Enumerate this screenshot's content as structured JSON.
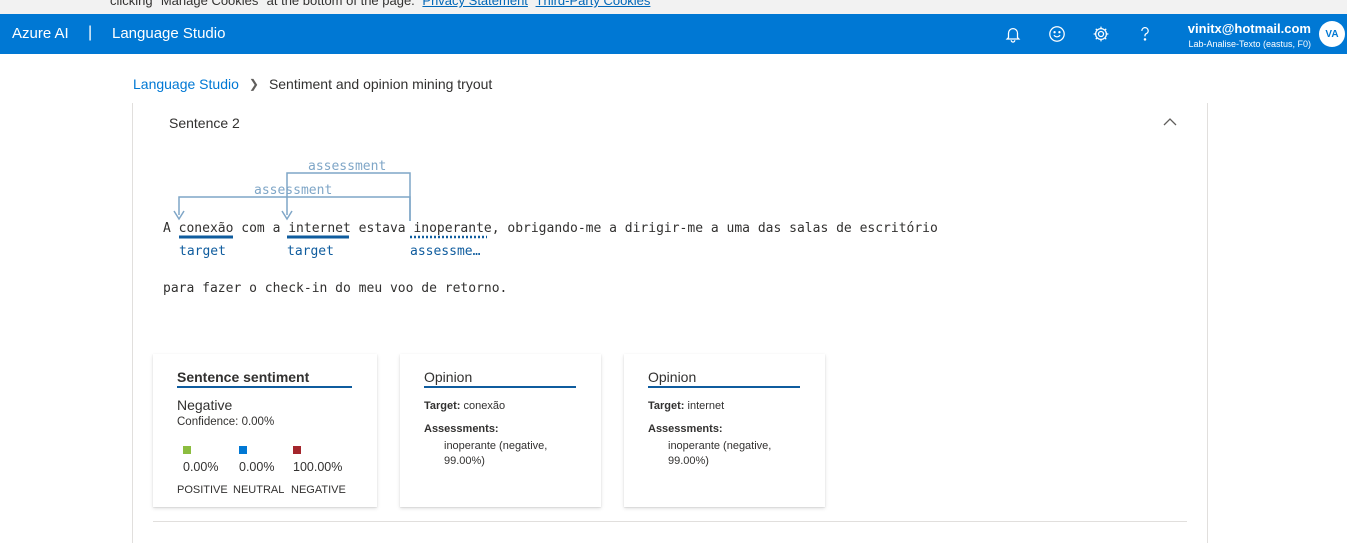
{
  "cookie_banner": {
    "text": "clicking \"Manage Cookies\" at the bottom of the page.",
    "privacy_link": "Privacy Statement",
    "third_party_link": "Third-Party Cookies"
  },
  "topbar": {
    "brand": "Azure AI",
    "separator": "|",
    "product": "Language Studio",
    "icons": [
      "bell-icon",
      "smiley-icon",
      "gear-icon",
      "help-icon"
    ],
    "user_email": "vinitx@hotmail.com",
    "user_tenant": "Lab-Analise-Texto (eastus, F0)",
    "avatar_initials": "VA",
    "bg_color": "#0078d4"
  },
  "breadcrumb": {
    "root": "Language Studio",
    "current": "Sentiment and opinion mining tryout"
  },
  "sentence": {
    "title": "Sentence 2",
    "line1": "A conexão com a internet estava inoperante, obrigando-me a dirigir-me a uma das salas de escritório",
    "line2": "para fazer o check-in do meu voo de retorno.",
    "tags": {
      "target1": "target",
      "target2": "target",
      "assessment": "assessme…"
    },
    "arc1_label": "assessment",
    "arc2_label": "assessment"
  },
  "sentence_card": {
    "title": "Sentence sentiment",
    "sentiment": "Negative",
    "confidence": "Confidence: 0.00%",
    "scores": [
      {
        "label": "POSITIVE",
        "value": "0.00%",
        "color": "#8cbd3f"
      },
      {
        "label": "NEUTRAL",
        "value": "0.00%",
        "color": "#0078d4"
      },
      {
        "label": "NEGATIVE",
        "value": "100.00%",
        "color": "#a4262c"
      }
    ]
  },
  "opinions": [
    {
      "title": "Opinion",
      "target_label": "Target:",
      "target_value": "conexão",
      "assessments_label": "Assessments:",
      "assessment_value": "inoperante (negative, 99.00%)"
    },
    {
      "title": "Opinion",
      "target_label": "Target:",
      "target_value": "internet",
      "assessments_label": "Assessments:",
      "assessment_value": "inoperante (negative, 99.00%)"
    }
  ]
}
